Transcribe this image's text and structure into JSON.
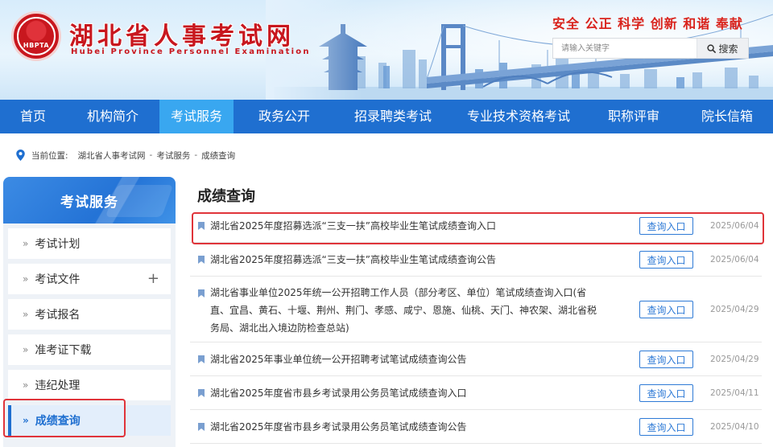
{
  "header": {
    "logo_text": "HBPTA",
    "site_title": "湖北省人事考试网",
    "site_subtitle": "Hubei Province Personnel Examination",
    "slogan": "安全 公正 科学 创新 和谐 奉献",
    "search": {
      "placeholder": "请输入关键字",
      "button_label": "搜索",
      "icon": "search-icon"
    }
  },
  "nav": {
    "active_index": 2,
    "items": [
      {
        "label": "首页"
      },
      {
        "label": "机构简介"
      },
      {
        "label": "考试服务"
      },
      {
        "label": "政务公开"
      },
      {
        "label": "招录聘类考试"
      },
      {
        "label": "专业技术资格考试"
      },
      {
        "label": "职称评审"
      },
      {
        "label": "院长信箱"
      }
    ]
  },
  "breadcrumb": {
    "prefix": "当前位置:",
    "separator": "-",
    "items": [
      "湖北省人事考试网",
      "考试服务",
      "成绩查询"
    ]
  },
  "sidebar": {
    "title": "考试服务",
    "active_index": 5,
    "items": [
      {
        "label": "考试计划",
        "expandable": false
      },
      {
        "label": "考试文件",
        "expandable": true
      },
      {
        "label": "考试报名",
        "expandable": false
      },
      {
        "label": "准考证下载",
        "expandable": false
      },
      {
        "label": "违纪处理",
        "expandable": false
      },
      {
        "label": "成绩查询",
        "expandable": false
      }
    ]
  },
  "main": {
    "title": "成绩查询",
    "button_label": "查询入口",
    "rows": [
      {
        "title": "湖北省2025年度招募选派“三支一扶”高校毕业生笔试成绩查询入口",
        "date": "2025/06/04"
      },
      {
        "title": "湖北省2025年度招募选派“三支一扶”高校毕业生笔试成绩查询公告",
        "date": "2025/06/04"
      },
      {
        "title": "湖北省事业单位2025年统一公开招聘工作人员（部分考区、单位）笔试成绩查询入口(省直、宜昌、黄石、十堰、荆州、荆门、孝感、咸宁、恩施、仙桃、天门、神农架、湖北省税务局、湖北出入境边防检查总站)",
        "date": "2025/04/29"
      },
      {
        "title": "湖北省2025年事业单位统一公开招聘考试笔试成绩查询公告",
        "date": "2025/04/29"
      },
      {
        "title": "湖北省2025年度省市县乡考试录用公务员笔试成绩查询入口",
        "date": "2025/04/11"
      },
      {
        "title": "湖北省2025年度省市县乡考试录用公务员笔试成绩查询公告",
        "date": "2025/04/10"
      }
    ]
  },
  "colors": {
    "brand_red": "#c8171e",
    "nav_blue": "#1f6fd0",
    "nav_active": "#39a7f0",
    "highlight_red": "#e0343a"
  }
}
